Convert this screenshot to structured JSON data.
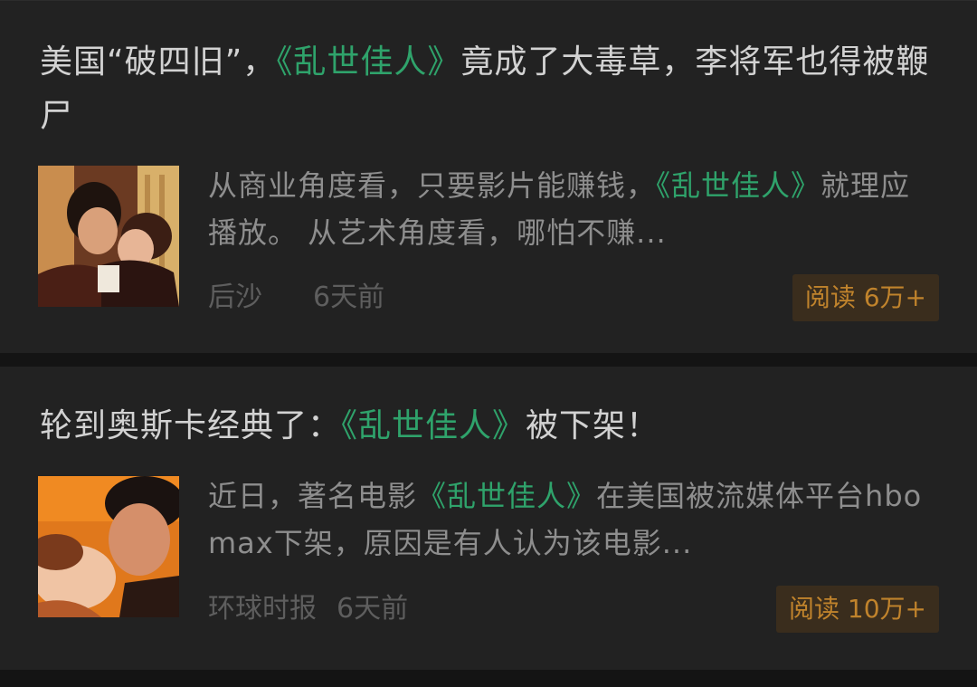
{
  "articles": [
    {
      "title_pre": "美国“破四旧”，",
      "title_hl": "《乱世佳人》",
      "title_post": "竟成了大毒草，李将军也得被鞭尸",
      "summary_pre": "从商业角度看，只要影片能赚钱，",
      "summary_hl": "《乱世佳人》",
      "summary_post": "就理应播放。 从艺术角度看，哪怕不赚...",
      "source": "后沙",
      "time": "6天前",
      "reads": "阅读 6万+",
      "thumbnail_icon": "movie-kiss-thumbnail"
    },
    {
      "title_pre": "轮到奥斯卡经典了：",
      "title_hl": "《乱世佳人》",
      "title_post": "被下架！",
      "summary_pre": "近日，著名电影",
      "summary_hl": "《乱世佳人》",
      "summary_post": "在美国被流媒体平台hbo max下架，原因是有人认为该电影...",
      "source": "环球时报",
      "time": "6天前",
      "reads": "阅读 10万+",
      "thumbnail_icon": "movie-kiss-thumbnail"
    }
  ],
  "colors": {
    "background": "#141414",
    "card": "#222222",
    "highlight": "#2fa36b",
    "badge_text": "#c0832c",
    "badge_bg": "#3a2d1d"
  }
}
